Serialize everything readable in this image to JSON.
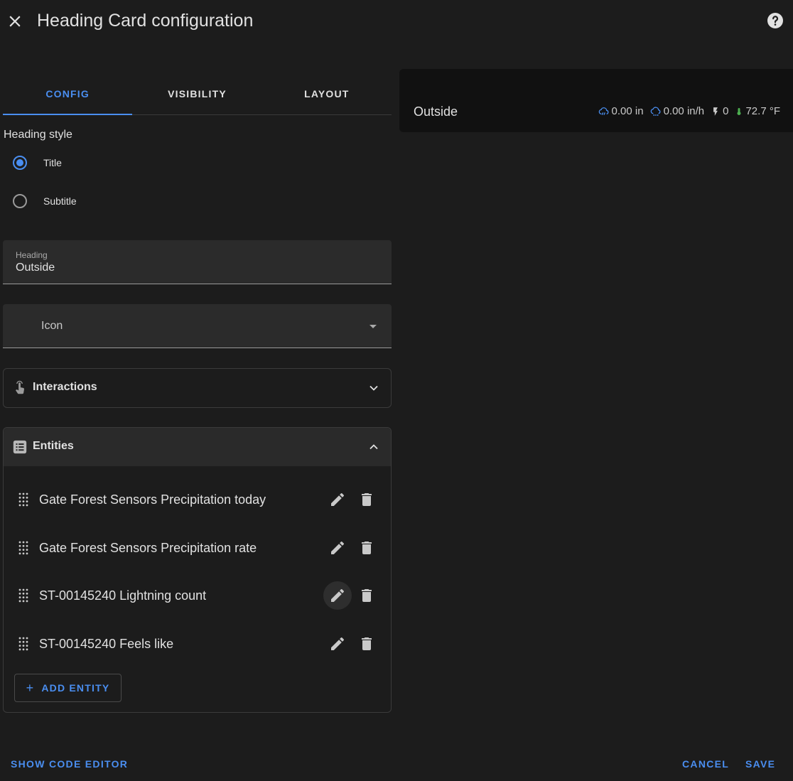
{
  "dialog": {
    "title": "Heading Card configuration"
  },
  "tabs": [
    {
      "label": "CONFIG",
      "active": true
    },
    {
      "label": "VISIBILITY",
      "active": false
    },
    {
      "label": "LAYOUT",
      "active": false
    }
  ],
  "heading_style": {
    "label": "Heading style",
    "options": [
      {
        "label": "Title",
        "checked": true
      },
      {
        "label": "Subtitle",
        "checked": false
      }
    ]
  },
  "heading_field": {
    "label": "Heading",
    "value": "Outside"
  },
  "icon_field": {
    "label": "Icon"
  },
  "interactions": {
    "title": "Interactions",
    "expanded": false
  },
  "entities": {
    "title": "Entities",
    "expanded": true,
    "items": [
      {
        "name": "Gate Forest Sensors Precipitation today"
      },
      {
        "name": "Gate Forest Sensors Precipitation rate"
      },
      {
        "name": "ST-00145240 Lightning count"
      },
      {
        "name": "ST-00145240 Feels like"
      }
    ],
    "add_label": "ADD ENTITY"
  },
  "footer": {
    "code_editor_label": "SHOW CODE EDITOR",
    "cancel_label": "CANCEL",
    "save_label": "SAVE"
  },
  "preview": {
    "title": "Outside",
    "badges": [
      {
        "icon": "weather-pouring-icon",
        "value": "0.00 in",
        "color": "#4a8ef0"
      },
      {
        "icon": "weather-rainy-icon",
        "value": "0.00 in/h",
        "color": "#4a8ef0"
      },
      {
        "icon": "flash-icon",
        "value": "0",
        "color": "#c9c9c9"
      },
      {
        "icon": "thermometer-icon",
        "value": "72.7 °F",
        "color": "#4caf50"
      }
    ]
  },
  "colors": {
    "accent": "#4a8ef0",
    "background": "#1c1c1c",
    "surface": "#2b2b2b"
  }
}
